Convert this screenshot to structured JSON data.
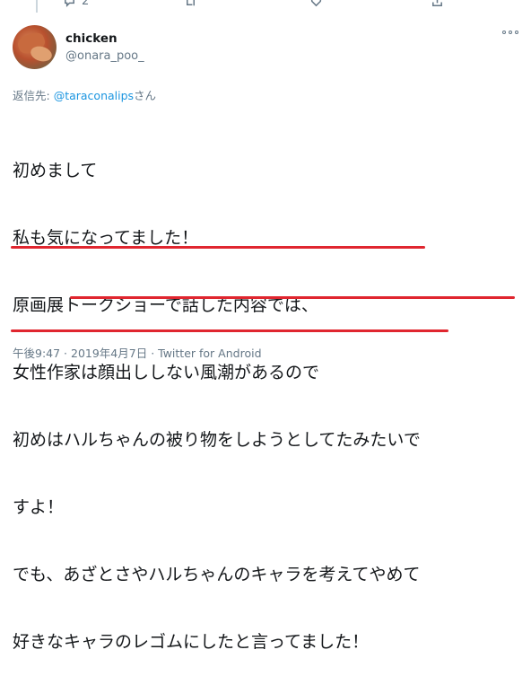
{
  "previous_tweet": {
    "reply_count": "2",
    "icons": [
      "reply-icon",
      "retweet-icon",
      "like-icon",
      "share-icon"
    ]
  },
  "tweet": {
    "display_name": "chicken",
    "handle": "@onara_poo_",
    "reply_to_prefix": "返信先: ",
    "reply_to_mention": "@taraconalips",
    "reply_to_suffix": "さん",
    "lines": [
      "初めまして",
      "私も気になってました！",
      "原画展トークショーで話した内容では、",
      "女性作家は顔出ししない風潮があるので",
      "初めはハルちゃんの被り物をしようとしてたみたいで",
      "すよ！",
      "でも、あざとさやハルちゃんのキャラを考えてやめて",
      "好きなキャラのレゴムにしたと言ってました！"
    ],
    "time": "午後9:47",
    "separator": " · ",
    "date": "2019年4月7日",
    "source": "Twitter for Android"
  },
  "colors": {
    "accent": "#1b95e0",
    "secondary_text": "#657786",
    "underline": "#e0262f"
  }
}
